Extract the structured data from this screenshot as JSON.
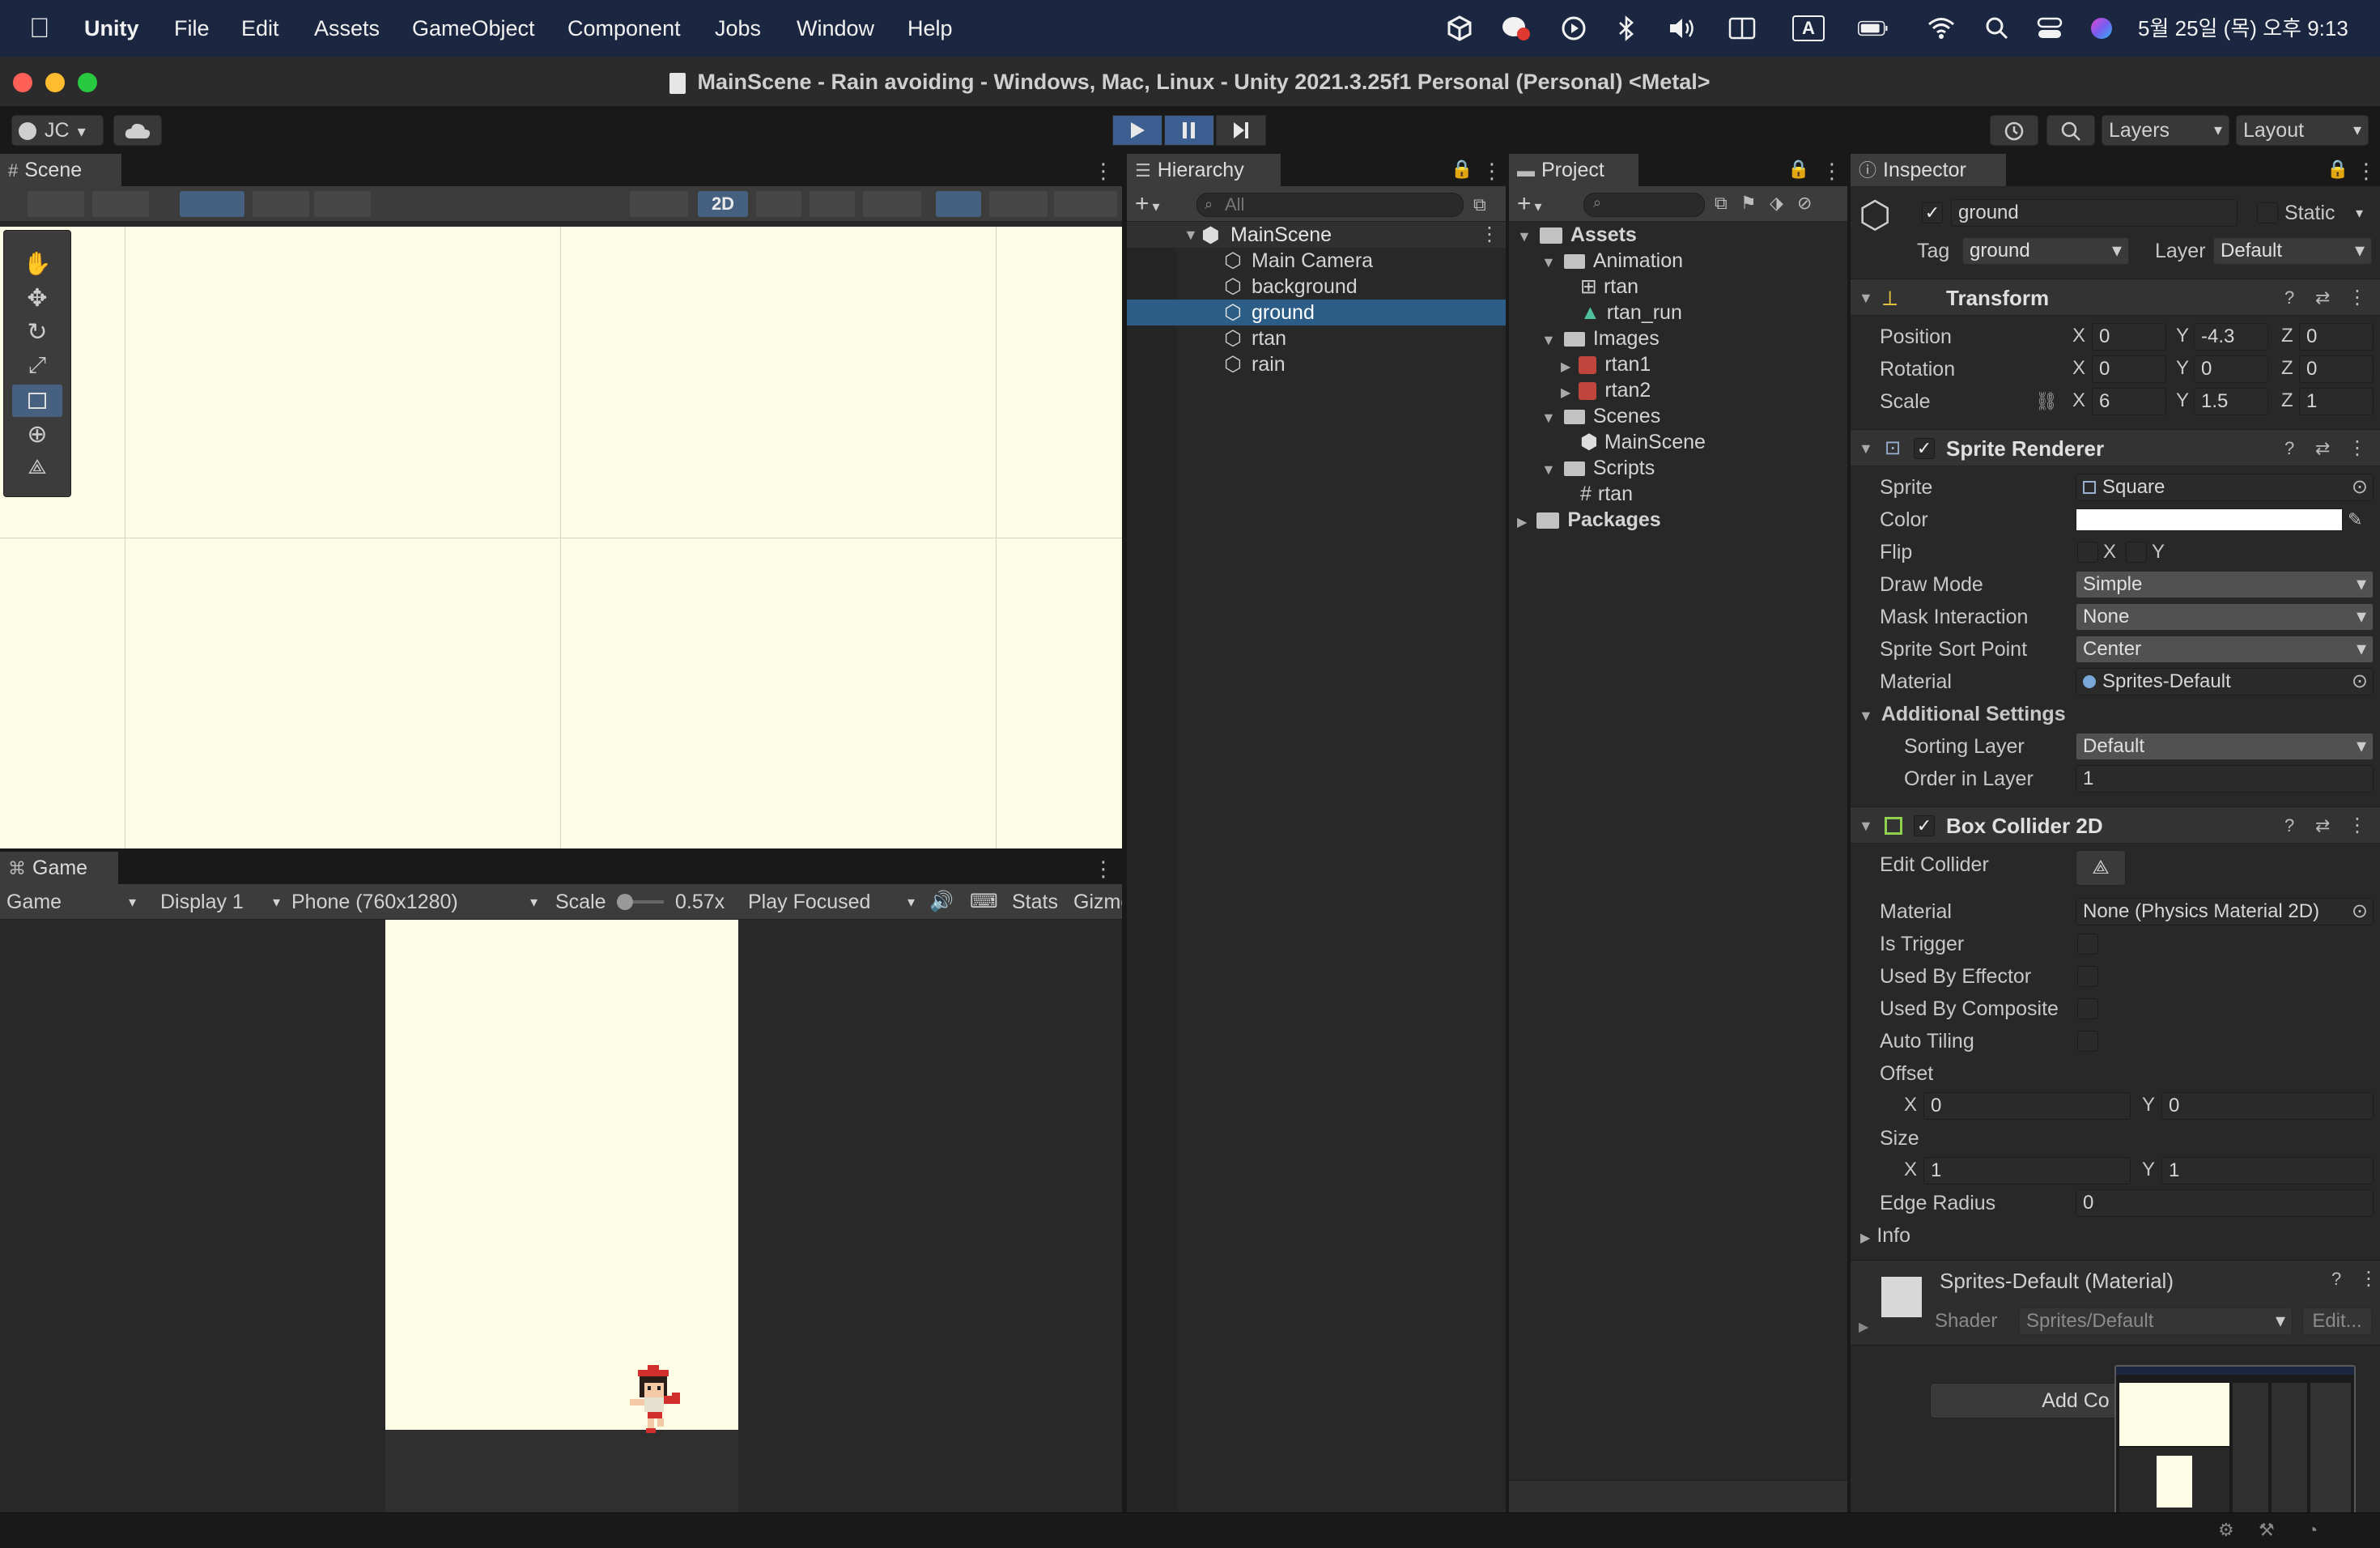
{
  "menubar": {
    "app": "Unity",
    "items": [
      "File",
      "Edit",
      "Assets",
      "GameObject",
      "Component",
      "Jobs",
      "Window",
      "Help"
    ],
    "clock": "5월 25일 (목) 오후 9:13",
    "icons": [
      "unity-icon",
      "chat-icon",
      "play-circle-icon",
      "bluetooth-icon",
      "volume-icon",
      "input-icon",
      "keyboard-a-icon",
      "battery-icon",
      "wifi-icon",
      "spotlight-icon",
      "control-center-icon",
      "siri-icon"
    ],
    "input_label": "A"
  },
  "window": {
    "title": "MainScene - Rain avoiding - Windows, Mac, Linux - Unity 2021.3.25f1 Personal (Personal) <Metal>"
  },
  "toolbar": {
    "account": "JC",
    "layers": "Layers",
    "layout": "Layout"
  },
  "scene": {
    "tab": "Scene",
    "mode2d": "2D",
    "bg_color": "#fdfce5"
  },
  "game": {
    "tab": "Game",
    "dropdown_game": "Game",
    "display": "Display 1",
    "resolution": "Phone (760x1280)",
    "scale_label": "Scale",
    "scale_value": "0.57x",
    "play_focused": "Play Focused",
    "stats": "Stats",
    "gizmos": "Gizmos"
  },
  "hierarchy": {
    "tab": "Hierarchy",
    "search_placeholder": "All",
    "root": "MainScene",
    "items": [
      "Main Camera",
      "background",
      "ground",
      "rtan",
      "rain"
    ],
    "selected": "ground"
  },
  "project": {
    "tab": "Project",
    "assets": "Assets",
    "animation": "Animation",
    "anim_items": [
      "rtan",
      "rtan_run"
    ],
    "images": "Images",
    "image_items": [
      "rtan1",
      "rtan2"
    ],
    "scenes": "Scenes",
    "scene_items": [
      "MainScene"
    ],
    "scripts": "Scripts",
    "script_items": [
      "rtan"
    ],
    "packages": "Packages"
  },
  "inspector": {
    "tab": "Inspector",
    "object_name": "ground",
    "static_label": "Static",
    "tag_label": "Tag",
    "tag_value": "ground",
    "layer_label": "Layer",
    "layer_value": "Default",
    "transform": {
      "title": "Transform",
      "position_label": "Position",
      "position": [
        "0",
        "-4.3",
        "0"
      ],
      "rotation_label": "Rotation",
      "rotation": [
        "0",
        "0",
        "0"
      ],
      "scale_label": "Scale",
      "scale": [
        "6",
        "1.5",
        "1"
      ]
    },
    "sprite_renderer": {
      "title": "Sprite Renderer",
      "sprite_label": "Sprite",
      "sprite": "Square",
      "color_label": "Color",
      "flip_label": "Flip",
      "flip_x": "X",
      "flip_y": "Y",
      "draw_mode_label": "Draw Mode",
      "draw_mode": "Simple",
      "mask_label": "Mask Interaction",
      "mask": "None",
      "sort_point_label": "Sprite Sort Point",
      "sort_point": "Center",
      "material_label": "Material",
      "material": "Sprites-Default",
      "additional": "Additional Settings",
      "sorting_layer_label": "Sorting Layer",
      "sorting_layer": "Default",
      "order_label": "Order in Layer",
      "order": "1"
    },
    "box_collider": {
      "title": "Box Collider 2D",
      "edit_label": "Edit Collider",
      "material_label": "Material",
      "material": "None (Physics Material 2D)",
      "is_trigger": "Is Trigger",
      "used_by_effector": "Used By Effector",
      "used_by_composite": "Used By Composite",
      "auto_tiling": "Auto Tiling",
      "offset_label": "Offset",
      "offset": [
        "0",
        "0"
      ],
      "size_label": "Size",
      "size": [
        "1",
        "1"
      ],
      "edge_radius_label": "Edge Radius",
      "edge_radius": "0",
      "info": "Info"
    },
    "material_block": {
      "title": "Sprites-Default (Material)",
      "shader_label": "Shader",
      "shader": "Sprites/Default",
      "edit": "Edit..."
    },
    "add_component": "Add Co"
  },
  "axis": {
    "x": "X",
    "y": "Y",
    "z": "Z"
  }
}
